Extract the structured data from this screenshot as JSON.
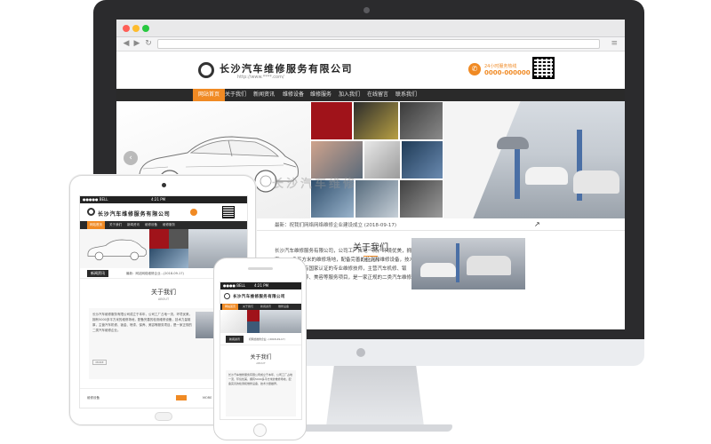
{
  "desktop": {
    "company": "长沙汽车维修服务有限公司",
    "site_url": "http://www.****.com/",
    "hotline": {
      "label": "24小时服务热线",
      "number": "0000-000000"
    },
    "nav": [
      "网站首页",
      "关于我们",
      "新闻资讯",
      "维修设备",
      "维修服务",
      "加入我们",
      "在线留言",
      "联系我们"
    ],
    "banner_watermark": "长沙汽车维修",
    "announcement": "最新：祝我们网络网络维修企业建设成立 (2018-09-17)",
    "about": {
      "title": "关于我们",
      "subtitle": "ABOUT",
      "text": "长沙汽车维修服务有限公司，公司工厂占地一流，环境优美，拥有5000多平方米的维修场地，配备完善的检测和维修设备，技术力量雄厚，拥有国家认证的专业维修技师，主营汽车机修、钣金、喷漆、保养、美容等服务项目，是一家正规的二类汽车维修企业..."
    }
  },
  "tablet": {
    "status_left": "●●●●● BELL",
    "status_time": "4:21 PM",
    "company": "长沙汽车维修服务有限公司",
    "nav": [
      "网站首页",
      "关于我们",
      "新闻资讯",
      "维修设备",
      "维修服务"
    ],
    "news_badge": "新闻资讯",
    "news_text": "最新：网站网络维修企业...(2018-09-17)",
    "about_title": "关于我们",
    "about_sub": "ABOUT",
    "about_text": "长沙汽车维修服务有限公司成立于本年，公司工厂占地一流，环境优美，拥有5000多平方米的维修场地，配备完善的检测维修设备，技术力量雄厚，主营汽车机修、钣金、喷漆、保养、美容等服务项目，是一家正规的二类汽车维修企业。",
    "more": "MORE",
    "footer_label": "维修设备",
    "footer_more": "MORE"
  },
  "phone": {
    "status_left": "●●●● BELL",
    "status_time": "4:21 PM",
    "company": "长沙汽车维修服务有限公司",
    "nav": [
      "网站首页",
      "关于我们",
      "新闻资讯",
      "维修设备"
    ],
    "news_badge": "新闻资讯",
    "news_text": "祝网络维修企业...(2018-09-17)",
    "about_title": "关于我们",
    "about_sub": "ABOUT",
    "about_text": "长沙汽车维修服务有限公司成立于本年，公司工厂占地一流，环境优美，拥有5000多平方米的维修场地，配备完善的检测和维修设备，技术力量雄厚。"
  },
  "colors": {
    "accent": "#f08a24",
    "nav_bg": "#2a2a2a",
    "frame": "#2b2b2d"
  }
}
